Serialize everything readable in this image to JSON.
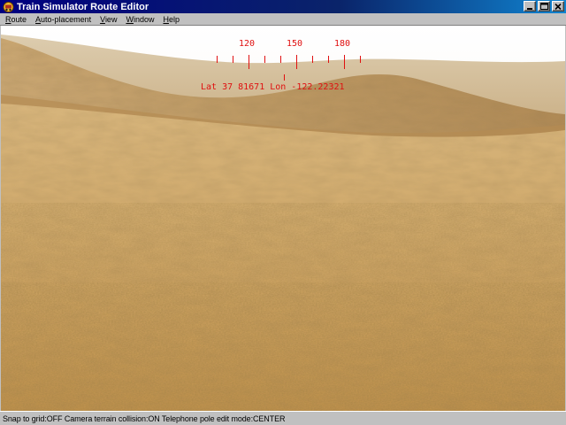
{
  "window": {
    "title": "Train Simulator Route Editor",
    "icon": "train-icon",
    "controls": {
      "minimize": "_",
      "maximize": "□",
      "close": "×"
    }
  },
  "menu": [
    {
      "label": "Route",
      "accel": "R"
    },
    {
      "label": "Auto-placement",
      "accel": "A"
    },
    {
      "label": "View",
      "accel": "V"
    },
    {
      "label": "Window",
      "accel": "W"
    },
    {
      "label": "Help",
      "accel": "H"
    }
  ],
  "hud": {
    "compass_labels": [
      "120",
      "150",
      "180"
    ],
    "lat_label": "Lat",
    "lat_value": "37 81671",
    "lon_label": "Lon",
    "lon_value": "-122.22321",
    "color": "#e01010"
  },
  "statusbar": {
    "text": "Snap to grid:OFF Camera terrain collision:ON Telephone pole edit mode:CENTER"
  },
  "colors": {
    "titlebar": "#000080",
    "chrome": "#c0c0c0",
    "sky": "#f4f2ee",
    "terrain_light": "#d8b883",
    "terrain_mid": "#c89a58",
    "terrain_dark": "#a8783a"
  }
}
